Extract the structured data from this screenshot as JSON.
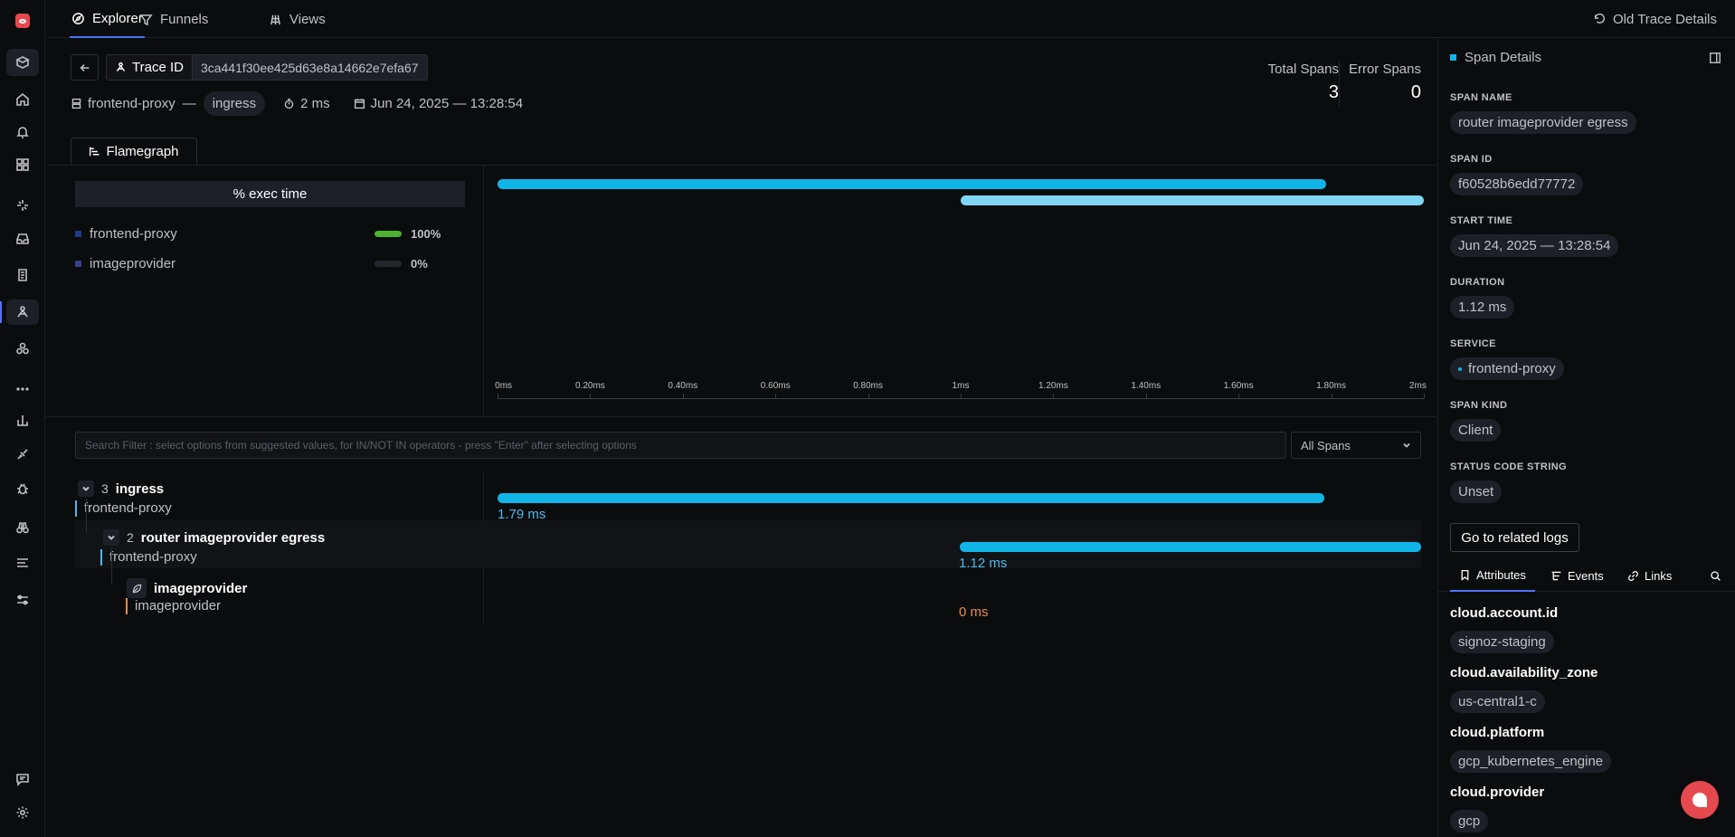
{
  "nav": {
    "tabs": [
      {
        "label": "Explorer",
        "icon": "compass-icon"
      },
      {
        "label": "Funnels",
        "icon": "funnel-icon"
      },
      {
        "label": "Views",
        "icon": "views-icon"
      }
    ],
    "old_trace_label": "Old Trace Details"
  },
  "header": {
    "trace_id_label": "Trace ID",
    "trace_id_value": "3ca441f30ee425d63e8a14662e7efa67",
    "service": "frontend-proxy",
    "separator": "—",
    "root_span": "ingress",
    "duration": "2 ms",
    "timestamp": "Jun 24, 2025 — 13:28:54",
    "total_spans_label": "Total Spans",
    "total_spans_value": "3",
    "error_spans_label": "Error Spans",
    "error_spans_value": "0"
  },
  "flamegraph": {
    "tab_label": "Flamegraph",
    "exec_time_header": "% exec time",
    "services": [
      {
        "name": "frontend-proxy",
        "percent": "100%",
        "fill": 1.0,
        "color": "#1f3a8a"
      },
      {
        "name": "imageprovider",
        "percent": "0%",
        "fill": 0.0,
        "color": "#3b3f8c"
      }
    ],
    "bars": [
      {
        "level": 0,
        "start_ms": 0,
        "end_ms": 1.79,
        "color": "#10b5e8"
      },
      {
        "level": 1,
        "start_ms": 1.0,
        "end_ms": 2.0,
        "color": "#7fd6f4"
      }
    ],
    "axis_ticks": [
      "0ms",
      "0.20ms",
      "0.40ms",
      "0.60ms",
      "0.80ms",
      "1ms",
      "1.20ms",
      "1.40ms",
      "1.60ms",
      "1.80ms",
      "2ms"
    ],
    "axis_max_ms": 2.0
  },
  "filter": {
    "search_placeholder": "Search Filter : select options from suggested values, for IN/NOT IN operators - press \"Enter\" after selecting options",
    "spans_select_value": "All Spans"
  },
  "waterfall": {
    "rows": [
      {
        "count": "3",
        "name": "ingress",
        "service": "frontend-proxy",
        "duration": "1.79 ms",
        "start_ms": 0,
        "end_ms": 1.79
      },
      {
        "count": "2",
        "name": "router imageprovider egress",
        "service": "frontend-proxy",
        "duration": "1.12 ms",
        "start_ms": 1.0,
        "end_ms": 2.0
      },
      {
        "count": "",
        "name": "imageprovider",
        "service": "imageprovider",
        "duration": "0 ms",
        "start_ms": 1.0,
        "end_ms": 1.0
      }
    ]
  },
  "span_details": {
    "title": "Span Details",
    "fields": [
      {
        "key": "SPAN NAME",
        "value": "router imageprovider egress"
      },
      {
        "key": "SPAN ID",
        "value": "f60528b6edd77772"
      },
      {
        "key": "START TIME",
        "value": "Jun 24, 2025 — 13:28:54"
      },
      {
        "key": "DURATION",
        "value": "1.12 ms"
      },
      {
        "key": "SERVICE",
        "value": "frontend-proxy"
      },
      {
        "key": "SPAN KIND",
        "value": "Client"
      },
      {
        "key": "STATUS CODE STRING",
        "value": "Unset"
      }
    ],
    "logs_button": "Go to related logs",
    "tabs": [
      {
        "label": "Attributes",
        "icon": "bookmark-icon"
      },
      {
        "label": "Events",
        "icon": "events-icon"
      },
      {
        "label": "Links",
        "icon": "link-icon"
      }
    ],
    "attributes": [
      {
        "key": "cloud.account.id",
        "value": "signoz-staging"
      },
      {
        "key": "cloud.availability_zone",
        "value": "us-central1-c"
      },
      {
        "key": "cloud.platform",
        "value": "gcp_kubernetes_engine"
      },
      {
        "key": "cloud.provider",
        "value": "gcp"
      }
    ]
  }
}
